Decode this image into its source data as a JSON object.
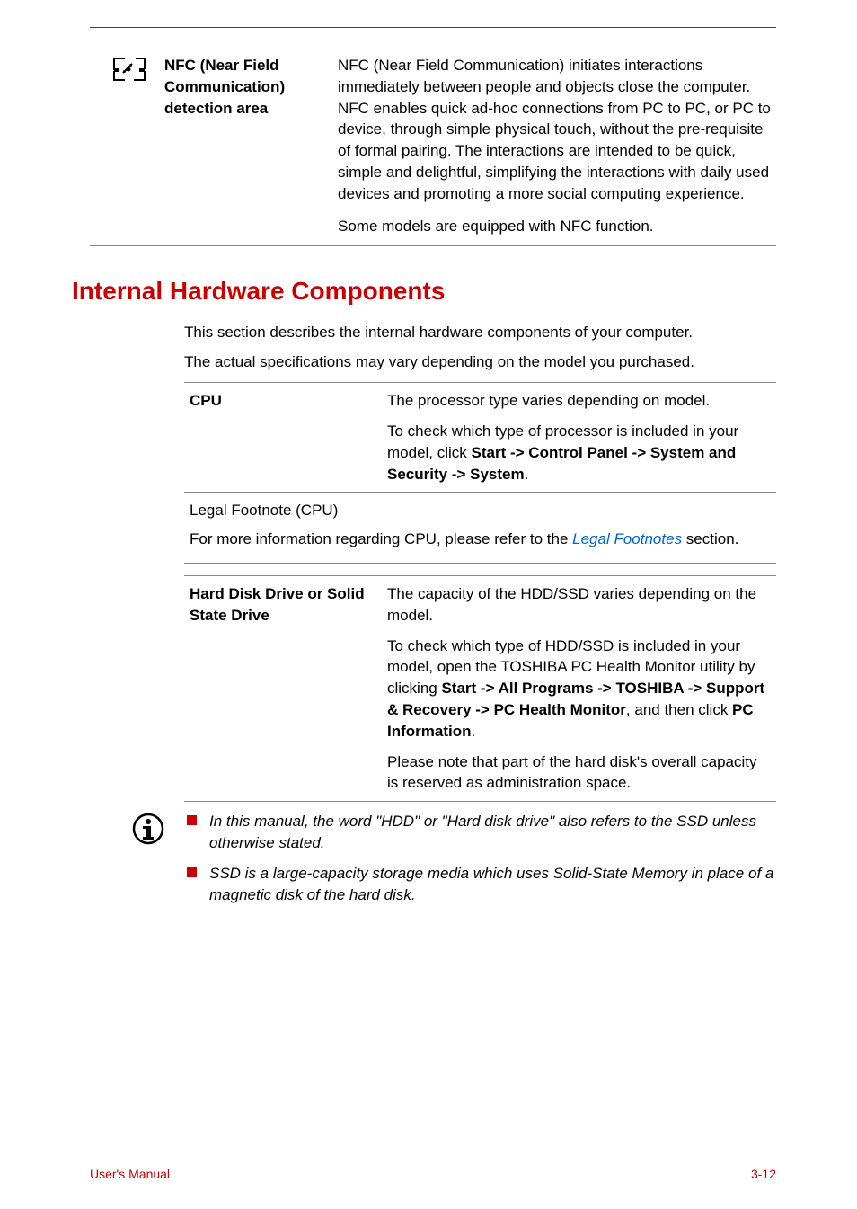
{
  "nfc": {
    "term": "NFC (Near Field Communication) detection area",
    "desc1": "NFC (Near Field Communication) initiates interactions immediately between people and objects close the computer. NFC enables quick ad-hoc connections from PC to PC, or PC to device, through simple physical touch, without the pre-requisite of formal pairing. The interactions are intended to be quick, simple and delightful, simplifying the interactions with daily used devices and promoting a more social computing experience.",
    "desc2": "Some models are equipped with NFC function."
  },
  "heading": "Internal Hardware Components",
  "intro": {
    "p1": "This section describes the internal hardware components of your computer.",
    "p2": "The actual specifications may vary depending on the model you purchased."
  },
  "cpu": {
    "label": "CPU",
    "desc1": "The processor type varies depending on model.",
    "desc2_pre": "To check which type of processor is included in your model, click ",
    "desc2_bold": "Start -> Control Panel -> System and Security -> System",
    "desc2_post": "."
  },
  "cpu_footnote": {
    "title": "Legal Footnote (CPU)",
    "text_pre": "For more information regarding CPU, please refer to the ",
    "link": "Legal Footnotes",
    "text_post": " section."
  },
  "hdd": {
    "label": "Hard Disk Drive or Solid State Drive",
    "desc1": "The capacity of the HDD/SSD varies depending on the model.",
    "desc2_pre": "To check which type of HDD/SSD is included in your model, open the TOSHIBA PC Health Monitor utility by clicking ",
    "desc2_bold1": "Start -> All Programs -> TOSHIBA -> Support & Recovery -> PC Health Monitor",
    "desc2_mid": ", and then click ",
    "desc2_bold2": "PC Information",
    "desc2_post": ".",
    "desc3": "Please note that part of the hard disk's overall capacity is reserved as administration space."
  },
  "notes": {
    "item1": "In this manual, the word \"HDD\" or \"Hard disk drive\" also refers to the SSD unless otherwise stated.",
    "item2": "SSD is a large-capacity storage media which uses Solid-State Memory in place of a magnetic disk of the hard disk."
  },
  "footer": {
    "left": "User's Manual",
    "right": "3-12"
  }
}
